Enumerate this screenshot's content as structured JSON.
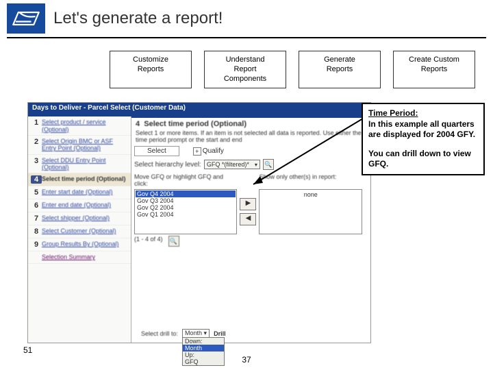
{
  "header": {
    "title": "Let's generate a report!"
  },
  "nav": [
    {
      "label": "Customize\nReports"
    },
    {
      "label": "Understand\nReport\nComponents"
    },
    {
      "label": "Generate\nReports"
    },
    {
      "label": "Create Custom\nReports"
    }
  ],
  "app": {
    "title": "Days to Deliver - Parcel Select (Customer Data)",
    "steps": [
      {
        "num": "1",
        "label": "Select product / service (Optional)",
        "active": false
      },
      {
        "num": "2",
        "label": "Select Origin BMC or ASF Entry Point (Optional)",
        "active": false
      },
      {
        "num": "3",
        "label": "Select DDU Entry Point (Optional)",
        "active": false
      },
      {
        "num": "4",
        "label": "Select time period (Optional)",
        "active": true
      },
      {
        "num": "5",
        "label": "Enter start date (Optional)",
        "active": false
      },
      {
        "num": "6",
        "label": "Enter end date (Optional)",
        "active": false
      },
      {
        "num": "7",
        "label": "Select shipper (Optional)",
        "active": false
      },
      {
        "num": "8",
        "label": "Select Customer (Optional)",
        "active": false
      },
      {
        "num": "9",
        "label": "Group Results By (Optional)",
        "active": false
      },
      {
        "num": "",
        "label": "Selection Summary",
        "active": false,
        "last": true
      }
    ],
    "main": {
      "heading_num": "4",
      "heading": "Select time period (Optional)",
      "desc": "Select 1 or more items. If an item is not selected all data is reported. Use either the time period prompt or the start and end",
      "tab_select": "Select",
      "qualify": "Qualify",
      "hierarchy_label": "Select hierarchy level:",
      "hierarchy_value": "GFQ *(filtered)*",
      "left_label": "Move GFQ or highlight GFQ and click:",
      "right_label": "Show only other(s) in report:",
      "left_items": [
        "Gov Q4 2004",
        "Gov Q3 2004",
        "Gov Q2 2004",
        "Gov Q1 2004"
      ],
      "left_selected": 0,
      "none": "none",
      "count": "(1 - 4 of 4)",
      "drill_label": "Select drill to:",
      "drill_value": "Month",
      "drill_button": "Drill",
      "drill_options": [
        "Down:",
        "Month",
        "Up:",
        "GFQ"
      ]
    }
  },
  "callout": {
    "title": "Time Period:",
    "line1": "In this example all quarters are displayed for 2004 GFY.",
    "line2": "You can drill down to view GFQ."
  },
  "page_number": "37",
  "corner_label": "51"
}
